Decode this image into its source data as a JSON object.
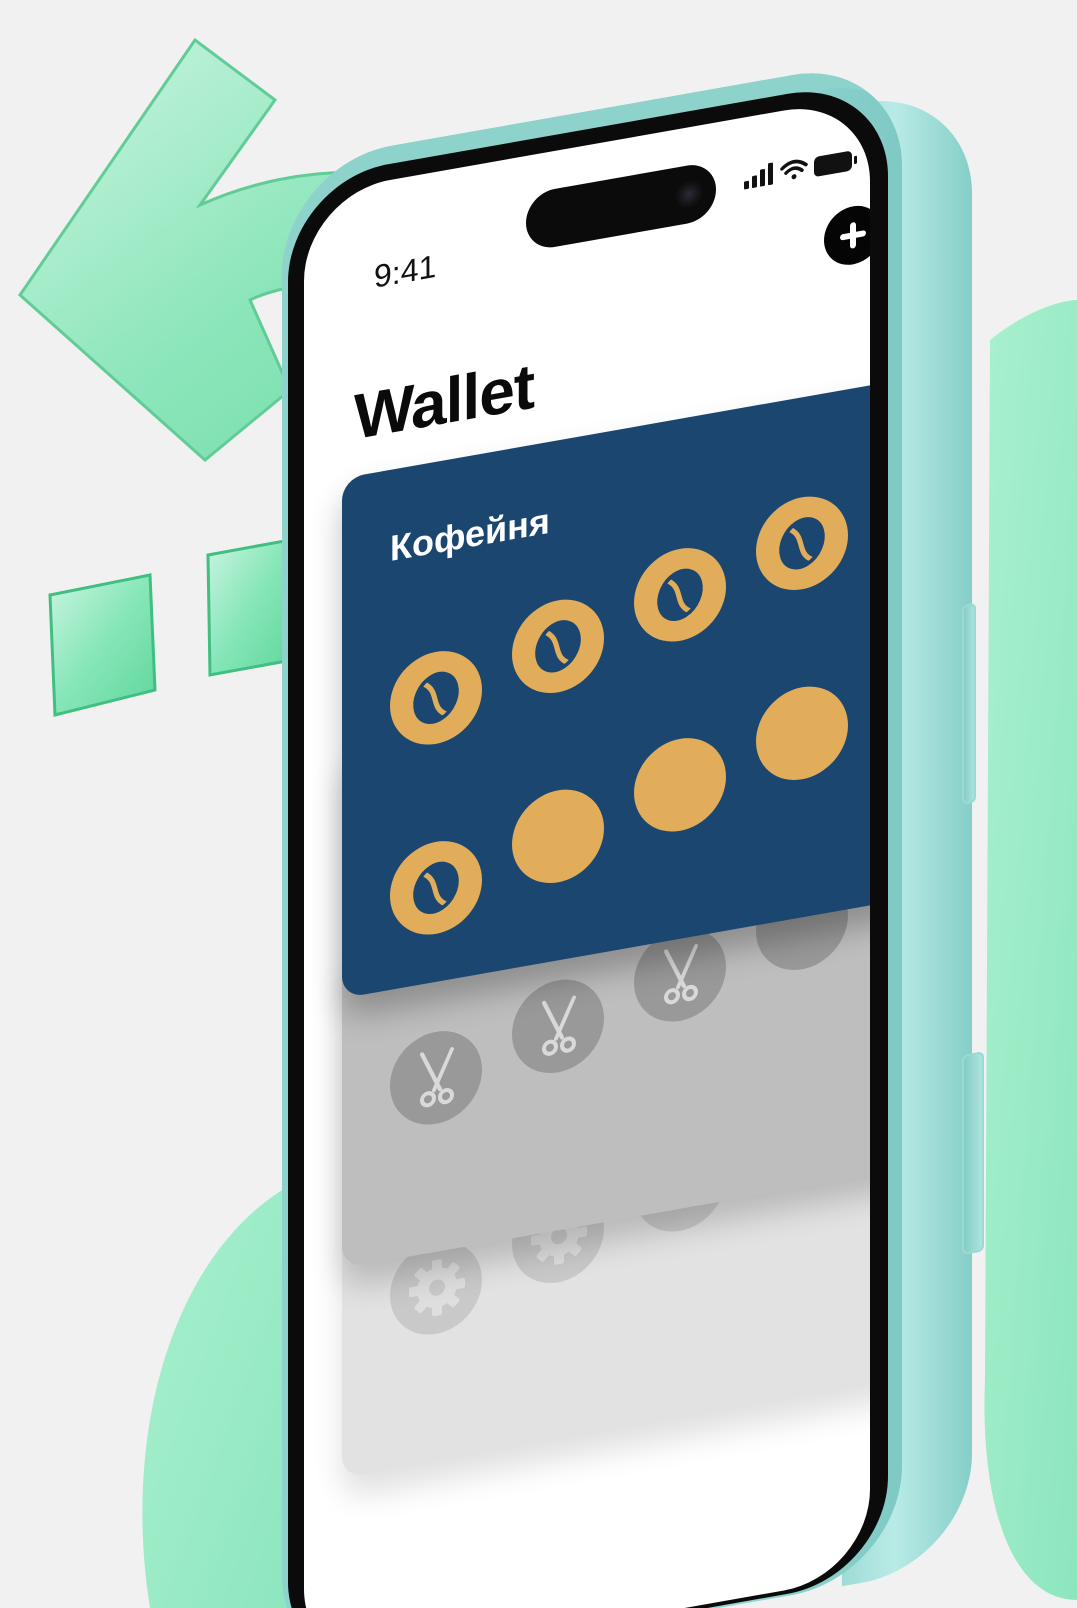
{
  "status_bar": {
    "time": "9:41",
    "icons": [
      "signal-icon",
      "wifi-icon",
      "battery-icon"
    ]
  },
  "header": {
    "add_button_icon": "plus-icon"
  },
  "page": {
    "title": "Wallet"
  },
  "cards": [
    {
      "name": "Кофейня",
      "background_color": "#1a4670",
      "stamp_color": "#e2ad5a",
      "stamp_icon": "coffee-bean-icon",
      "stamps_total": 8,
      "stamps_collected": 5
    },
    {
      "name": "",
      "background_color": "#bebebe",
      "stamp_color": "#999999",
      "stamp_icon": "scissors-icon",
      "stamps_total": 4,
      "stamps_collected": 3
    },
    {
      "name": "",
      "background_color": "#e2e2e2",
      "stamp_color": "#c9c9c9",
      "stamp_icon": "gear-icon",
      "stamps_total": 4,
      "stamps_collected": 2
    }
  ],
  "colors": {
    "accent_mint": "#7ee3b6",
    "phone_frame": "#9fdcd6",
    "background": "#f1f1f2"
  }
}
